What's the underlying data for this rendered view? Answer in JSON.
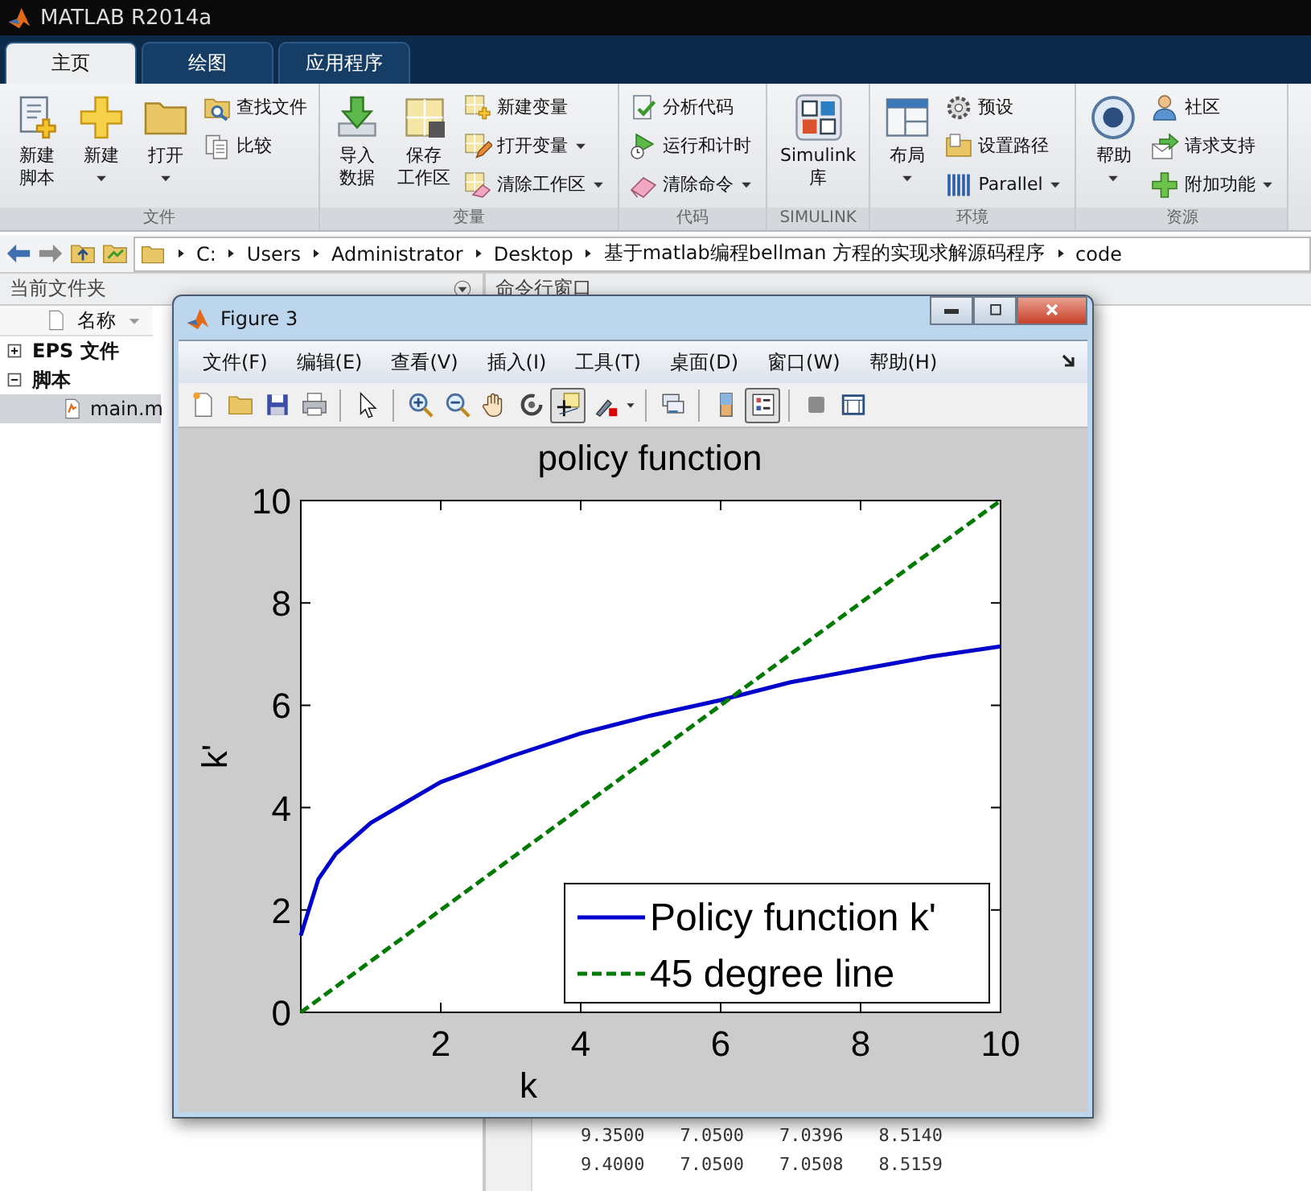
{
  "app_title": "MATLAB R2014a",
  "tabs": [
    {
      "label": "主页",
      "selected": true
    },
    {
      "label": "绘图",
      "selected": false
    },
    {
      "label": "应用程序",
      "selected": false
    }
  ],
  "ribbon_groups": [
    {
      "label": "文件",
      "items": [
        {
          "kind": "large",
          "lines": [
            "新建",
            "脚本"
          ],
          "dropdown": false
        },
        {
          "kind": "large",
          "lines": [
            "新建"
          ],
          "dropdown": true
        },
        {
          "kind": "large",
          "lines": [
            "打开"
          ],
          "dropdown": true
        },
        {
          "kind": "stack",
          "items": [
            {
              "label": "查找文件",
              "dropdown": false
            },
            {
              "label": "比较",
              "dropdown": false
            }
          ]
        }
      ]
    },
    {
      "label": "变量",
      "items": [
        {
          "kind": "large",
          "lines": [
            "导入",
            "数据"
          ],
          "dropdown": false
        },
        {
          "kind": "large",
          "lines": [
            "保存",
            "工作区"
          ],
          "dropdown": false
        },
        {
          "kind": "stack",
          "items": [
            {
              "label": "新建变量",
              "dropdown": false
            },
            {
              "label": "打开变量",
              "dropdown": true
            },
            {
              "label": "清除工作区",
              "dropdown": true
            }
          ]
        }
      ]
    },
    {
      "label": "代码",
      "items": [
        {
          "kind": "stack",
          "items": [
            {
              "label": "分析代码",
              "dropdown": false
            },
            {
              "label": "运行和计时",
              "dropdown": false
            },
            {
              "label": "清除命令",
              "dropdown": true
            }
          ]
        }
      ]
    },
    {
      "label": "SIMULINK",
      "items": [
        {
          "kind": "large",
          "lines": [
            "Simulink",
            "库"
          ],
          "dropdown": false
        }
      ]
    },
    {
      "label": "环境",
      "items": [
        {
          "kind": "large",
          "lines": [
            "布局"
          ],
          "dropdown": true
        },
        {
          "kind": "stack",
          "items": [
            {
              "label": "预设",
              "dropdown": false
            },
            {
              "label": "设置路径",
              "dropdown": false
            },
            {
              "label": "Parallel",
              "dropdown": true
            }
          ]
        }
      ]
    },
    {
      "label": "资源",
      "items": [
        {
          "kind": "large",
          "lines": [
            "帮助"
          ],
          "dropdown": true
        },
        {
          "kind": "stack",
          "items": [
            {
              "label": "社区",
              "dropdown": false
            },
            {
              "label": "请求支持",
              "dropdown": false
            },
            {
              "label": "附加功能",
              "dropdown": true
            }
          ]
        }
      ]
    }
  ],
  "path": [
    "C:",
    "Users",
    "Administrator",
    "Desktop",
    "基于matlab编程bellman 方程的实现求解源码程序",
    "code"
  ],
  "file_panel": {
    "title": "当前文件夹",
    "column": "名称",
    "tree": [
      {
        "label": "EPS 文件",
        "expanded": false
      },
      {
        "label": "脚本",
        "expanded": true,
        "children": [
          {
            "label": "main.m",
            "selected": true
          }
        ]
      }
    ]
  },
  "command_window": {
    "title": "命令行窗口",
    "rows": [
      [
        "9.3500",
        "7.0500",
        "7.0396",
        "8.5140"
      ],
      [
        "9.4000",
        "7.0500",
        "7.0508",
        "8.5159"
      ]
    ]
  },
  "figure": {
    "title": "Figure 3",
    "menus": [
      "文件(F)",
      "编辑(E)",
      "查看(V)",
      "插入(I)",
      "工具(T)",
      "桌面(D)",
      "窗口(W)",
      "帮助(H)"
    ],
    "toolbar": [
      {
        "pressed": false
      },
      {
        "pressed": false
      },
      {
        "pressed": false
      },
      {
        "pressed": false
      },
      {
        "pressed": false
      },
      {
        "pressed": false
      },
      {
        "pressed": false
      },
      {
        "pressed": false
      },
      {
        "pressed": false
      },
      {
        "pressed": true
      },
      {
        "pressed": false
      },
      {
        "pressed": false
      },
      {
        "pressed": false
      },
      {
        "pressed": true
      },
      {
        "pressed": false
      },
      {
        "pressed": false
      }
    ],
    "chart_data": {
      "type": "line",
      "title": "policy function",
      "xlabel": "k",
      "ylabel": "k'",
      "x": [
        0,
        0.25,
        0.5,
        1,
        2,
        3,
        4,
        5,
        6,
        7,
        8,
        9,
        10
      ],
      "xlim": [
        0,
        10
      ],
      "ylim": [
        0,
        10
      ],
      "xticks": [
        2,
        4,
        6,
        8,
        10
      ],
      "yticks": [
        0,
        2,
        4,
        6,
        8,
        10
      ],
      "legend": "lower right",
      "series": [
        {
          "name": "Policy function k'",
          "color": "#0000cc",
          "line_style": "solid",
          "values": [
            1.5,
            2.6,
            3.1,
            3.7,
            4.5,
            5.0,
            5.45,
            5.8,
            6.1,
            6.45,
            6.7,
            6.95,
            7.15
          ]
        },
        {
          "name": "45 degree line",
          "color": "#007a00",
          "line_style": "dashed",
          "values": [
            0,
            0.25,
            0.5,
            1,
            2,
            3,
            4,
            5,
            6,
            7,
            8,
            9,
            10
          ]
        }
      ]
    }
  }
}
